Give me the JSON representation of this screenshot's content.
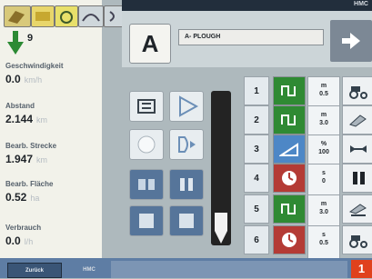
{
  "header": {
    "title": "HMC",
    "implement_name": "A- PLOUGH",
    "tool_letter": "A",
    "section_number": "9"
  },
  "metrics": [
    {
      "label": "Geschwindigkeit",
      "value": "0.0",
      "unit": "km/h"
    },
    {
      "label": "Abstand",
      "value": "2.144",
      "unit": "km"
    },
    {
      "label": "Bearb. Strecke",
      "value": "1.947",
      "unit": "km"
    },
    {
      "label": "Bearb. Fläche",
      "value": "0.52",
      "unit": "ha"
    },
    {
      "label": "Verbrauch",
      "value": "0.0",
      "unit": "l/h"
    }
  ],
  "sections": [
    {
      "num": "1",
      "state_icon": "valve-green-icon",
      "unit": "m",
      "value": "0.5",
      "right_icon": "tractor-icon"
    },
    {
      "num": "2",
      "state_icon": "valve-green-icon",
      "unit": "m",
      "value": "3.0",
      "right_icon": "plough-icon"
    },
    {
      "num": "3",
      "state_icon": "ramp-blue-icon",
      "unit": "%",
      "value": "100",
      "right_icon": "hitch-icon"
    },
    {
      "num": "4",
      "state_icon": "timer-red-icon",
      "unit": "s",
      "value": "0",
      "right_icon": "pause-icon"
    },
    {
      "num": "5",
      "state_icon": "valve-green-icon",
      "unit": "m",
      "value": "3.0",
      "right_icon": "plough-lower-icon"
    },
    {
      "num": "6",
      "state_icon": "timer-red-icon",
      "unit": "s",
      "value": "0.5",
      "right_icon": "tractor-icon"
    }
  ],
  "footer": {
    "back_label": "Zurück",
    "tab_label": "HMC",
    "figure_number": "1"
  },
  "colors": {
    "valve_green": "#2f8a33",
    "timer_red": "#b43b35",
    "ramp_blue": "#4d87c6",
    "bar_blue": "#5e7da4",
    "badge_red": "#e0411d"
  }
}
